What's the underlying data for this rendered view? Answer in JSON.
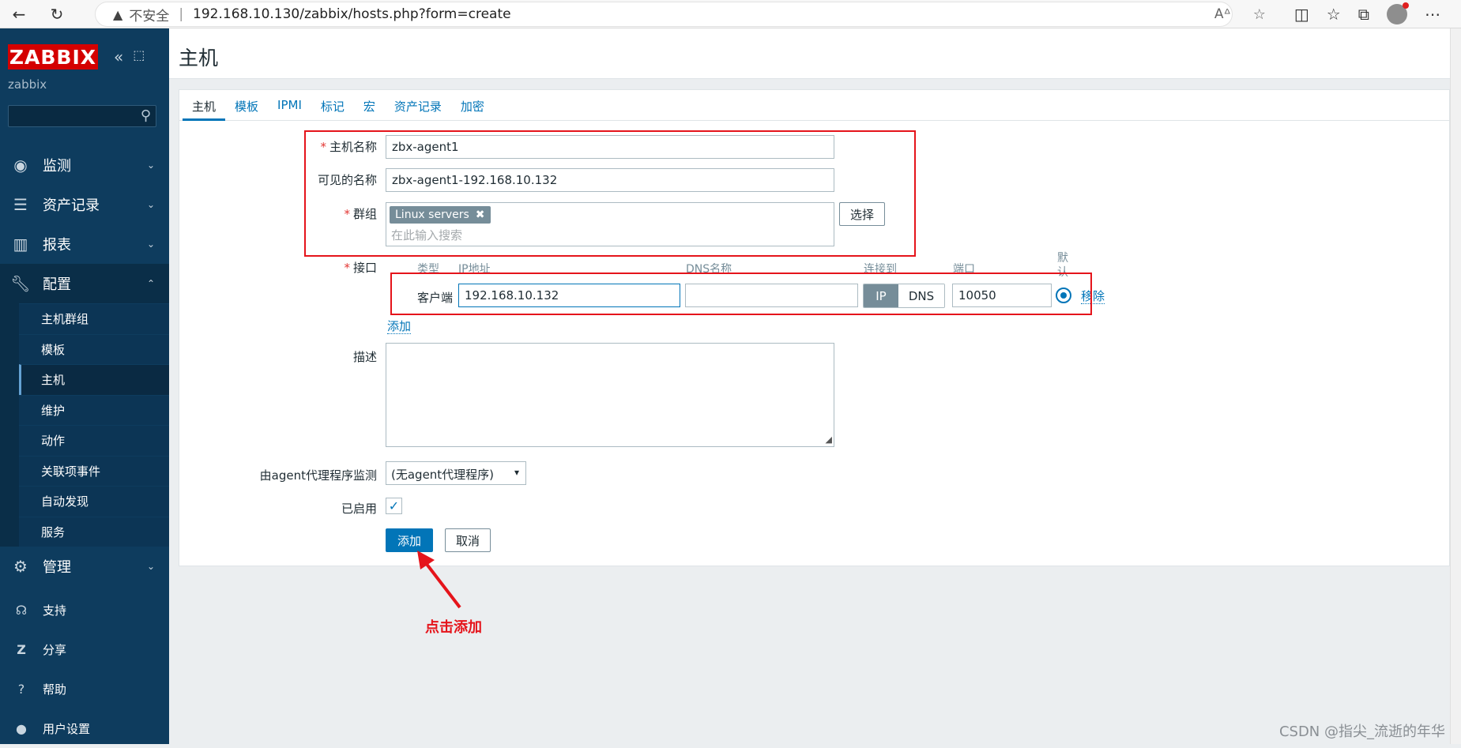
{
  "browser": {
    "insecure_label": "不安全",
    "url": "192.168.10.130/zabbix/hosts.php?form=create"
  },
  "sidebar": {
    "logo": "ZABBIX",
    "server_name": "zabbix",
    "search_value": "",
    "menu": [
      {
        "label": "监测",
        "icon": "eye-icon"
      },
      {
        "label": "资产记录",
        "icon": "list-icon"
      },
      {
        "label": "报表",
        "icon": "bar-chart-icon"
      },
      {
        "label": "配置",
        "icon": "wrench-icon"
      }
    ],
    "config_submenu": [
      "主机群组",
      "模板",
      "主机",
      "维护",
      "动作",
      "关联项事件",
      "自动发现",
      "服务"
    ],
    "admin_label": "管理",
    "bottom": [
      "支持",
      "分享",
      "帮助",
      "用户设置"
    ]
  },
  "page": {
    "title": "主机",
    "tabs": [
      "主机",
      "模板",
      "IPMI",
      "标记",
      "宏",
      "资产记录",
      "加密"
    ]
  },
  "form": {
    "host_name_label": "主机名称",
    "host_name_value": "zbx-agent1",
    "visible_name_label": "可见的名称",
    "visible_name_value": "zbx-agent1-192.168.10.132",
    "groups_label": "群组",
    "group_chip": "Linux servers",
    "groups_placeholder": "在此输入搜索",
    "select_button": "选择",
    "interfaces_label": "接口",
    "col_type": "类型",
    "col_ip": "IP地址",
    "col_dns": "DNS名称",
    "col_connect": "连接到",
    "col_port": "端口",
    "col_default": "默认",
    "agent_type": "客户端",
    "ip_value": "192.168.10.132",
    "dns_value": "",
    "connect_ip": "IP",
    "connect_dns": "DNS",
    "port_value": "10050",
    "remove_link": "移除",
    "add_link": "添加",
    "description_label": "描述",
    "proxy_label": "由agent代理程序监测",
    "proxy_value": "(无agent代理程序)",
    "enabled_label": "已启用",
    "add_button": "添加",
    "cancel_button": "取消"
  },
  "annotation": "点击添加",
  "watermark": "CSDN @指尖_流逝的年华"
}
